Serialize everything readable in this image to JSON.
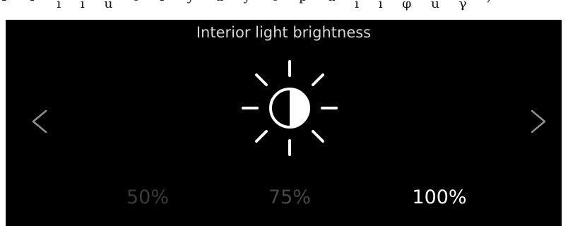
{
  "top_cut_text": "ᴾ ʳ ᵢ ᵢ ᵤ ᵒ ʳ ʸ ᵘ ʸ ᵒ ᵖ ᵘ ᵢ ᵢ ᵩ ᵤ ᵧ ⁾",
  "screen": {
    "title": "Interior light brightness",
    "icon": "brightness-sun-icon",
    "nav": {
      "prev_icon": "chevron-left-icon",
      "next_icon": "chevron-right-icon"
    },
    "levels": [
      {
        "label": "50%",
        "selected": false
      },
      {
        "label": "75%",
        "selected": false
      },
      {
        "label": "100%",
        "selected": true
      }
    ]
  },
  "colors": {
    "background": "#000000",
    "title": "#d6d6d6",
    "selected": "#ffffff",
    "unselected": "#3a3a3a"
  }
}
